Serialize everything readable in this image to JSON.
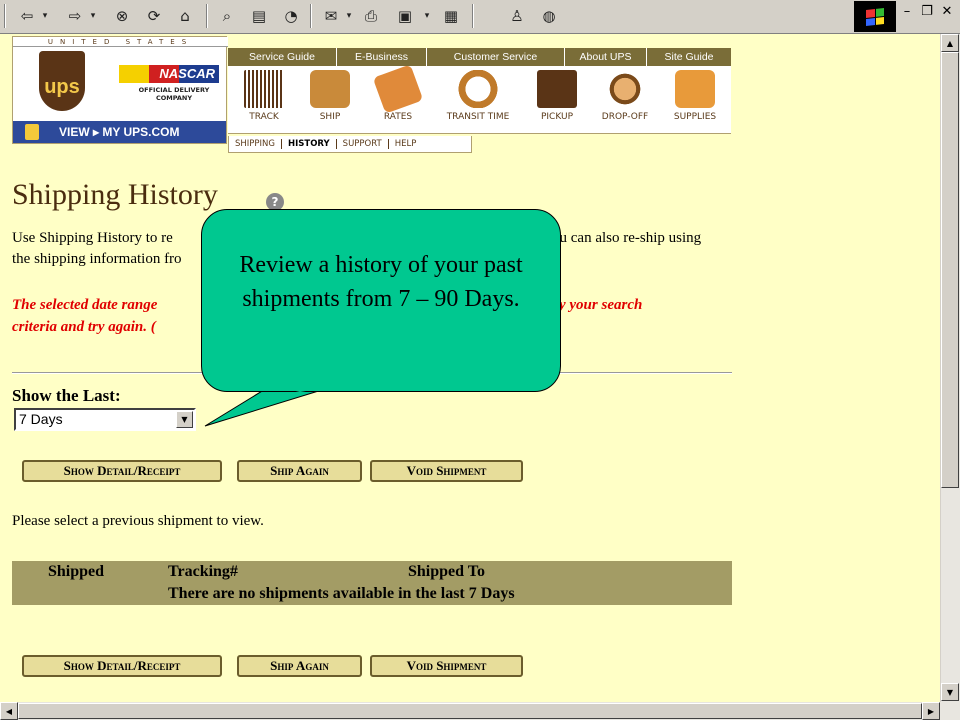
{
  "browser": {
    "toolbar_icons": [
      "back-icon",
      "forward-icon",
      "stop-icon",
      "refresh-icon",
      "home-icon",
      "search-icon",
      "favorites-icon",
      "history-icon",
      "mail-icon",
      "print-icon",
      "edit-icon",
      "discuss-icon",
      "messenger-icon",
      "chat-icon"
    ],
    "window_controls": [
      "minimize",
      "restore",
      "close"
    ]
  },
  "header": {
    "banner": "UNITED STATES",
    "logo": "ups",
    "sponsor": "NASCAR",
    "sponsor_caption": "OFFICIAL DELIVERY COMPANY",
    "myups_link": "VIEW ▸ MY UPS.COM",
    "tabs": [
      "Service Guide",
      "E-Business",
      "Customer Service",
      "About UPS",
      "Site Guide"
    ],
    "tools": [
      "TRACK",
      "SHIP",
      "RATES",
      "TRANSIT TIME",
      "PICKUP",
      "DROP-OFF",
      "SUPPLIES"
    ],
    "subtabs": [
      {
        "label": "SHIPPING",
        "active": false
      },
      {
        "label": "HISTORY",
        "active": true
      },
      {
        "label": "SUPPORT",
        "active": false
      },
      {
        "label": "HELP",
        "active": false
      }
    ]
  },
  "page": {
    "title": "Shipping History",
    "help_icon": "?",
    "intro_left": "Use Shipping History to re",
    "intro_right": "ou can also re-ship using",
    "intro_line2": "the shipping information fro",
    "error_left": "The selected date range",
    "error_right": "fy your search",
    "error_line2": "criteria and try again. (",
    "show_last_label": "Show the Last:",
    "range_value": "7 Days",
    "buttons": {
      "detail": "Show Detail/Receipt",
      "ship_again": "Ship Again",
      "void": "Void Shipment"
    },
    "select_msg": "Please select a previous shipment to view.",
    "table": {
      "headers": [
        "Shipped",
        "Tracking#",
        "Shipped To"
      ],
      "empty_msg": "There are no shipments available in the last 7 Days"
    }
  },
  "callout": {
    "text": "Review a history of your past shipments from 7 – 90 Days.",
    "color": "#00c890"
  },
  "colors": {
    "page_bg": "#ffffc6",
    "ups_brown": "#5a3416",
    "tab_olive": "#7a6d38",
    "table_bg": "#a39c65",
    "error_red": "#e00000"
  }
}
